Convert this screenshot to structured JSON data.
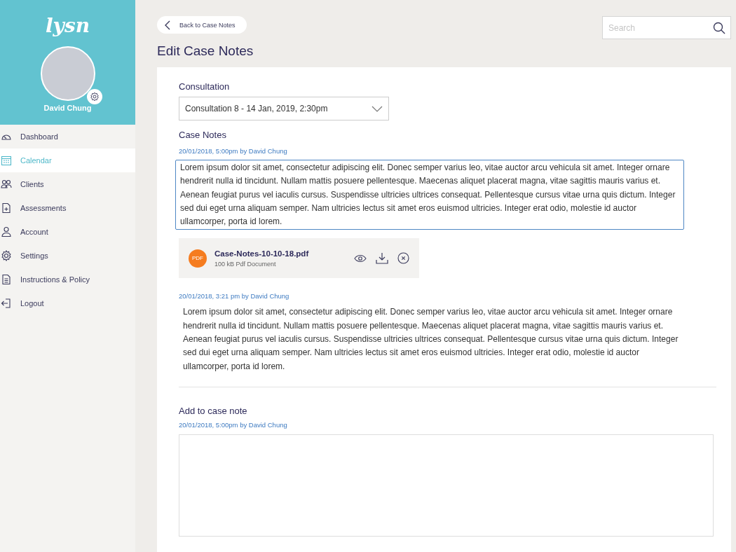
{
  "sidebar": {
    "logo": "lysn",
    "user_name": "David Chung",
    "items": [
      {
        "label": "Dashboard",
        "selected": false
      },
      {
        "label": "Calendar",
        "selected": true
      },
      {
        "label": "Clients",
        "selected": false
      },
      {
        "label": "Assessments",
        "selected": false
      },
      {
        "label": "Account",
        "selected": false
      },
      {
        "label": "Settings",
        "selected": false
      },
      {
        "label": "Instructions & Policy",
        "selected": false
      },
      {
        "label": "Logout",
        "selected": false
      }
    ]
  },
  "back_button": "Back to Case Notes",
  "search": {
    "placeholder": "Search"
  },
  "title": "Edit Case Notes",
  "consultation": {
    "label": "Consultation",
    "value": "Consultation 8 - 14 Jan, 2019, 2:30pm"
  },
  "case_notes": {
    "label": "Case Notes",
    "notes": [
      {
        "meta": "20/01/2018, 5:00pm by David Chung",
        "text": "Lorem ipsum dolor sit amet, consectetur adipiscing elit. Donec semper varius leo, vitae auctor arcu vehicula sit amet. Integer ornare hendrerit nulla id tincidunt. Nullam mattis posuere pellentesque. Maecenas aliquet placerat magna, vitae sagittis mauris varius et. Aenean feugiat purus vel iaculis cursus. Suspendisse ultricies ultrices consequat. Pellentesque cursus vitae urna quis dictum. Integer sed dui eget urna aliquam semper. Nam ultricies lectus sit amet eros euismod ultricies. Integer erat odio, molestie id auctor ullamcorper, porta id lorem.",
        "editing": true,
        "attachment": {
          "badge": "PDF",
          "name": "Case-Notes-10-10-18.pdf",
          "size": "100 kB",
          "type": "Pdf Document"
        }
      },
      {
        "meta": "20/01/2018, 3:21 pm by David Chung",
        "text": "Lorem ipsum dolor sit amet, consectetur adipiscing elit. Donec semper varius leo, vitae auctor arcu vehicula sit amet. Integer ornare hendrerit nulla id tincidunt. Nullam mattis posuere pellentesque. Maecenas aliquet placerat magna, vitae sagittis mauris varius et. Aenean feugiat purus vel iaculis cursus. Suspendisse ultricies ultrices consequat. Pellentesque cursus vitae urna quis dictum. Integer sed dui eget urna aliquam semper. Nam ultricies lectus sit amet eros euismod ultricies. Integer erat odio, molestie id auctor ullamcorper, porta id lorem.",
        "editing": false
      }
    ]
  },
  "add_note": {
    "label": "Add to case note",
    "meta": "20/01/2018, 5:00pm by David Chung"
  }
}
